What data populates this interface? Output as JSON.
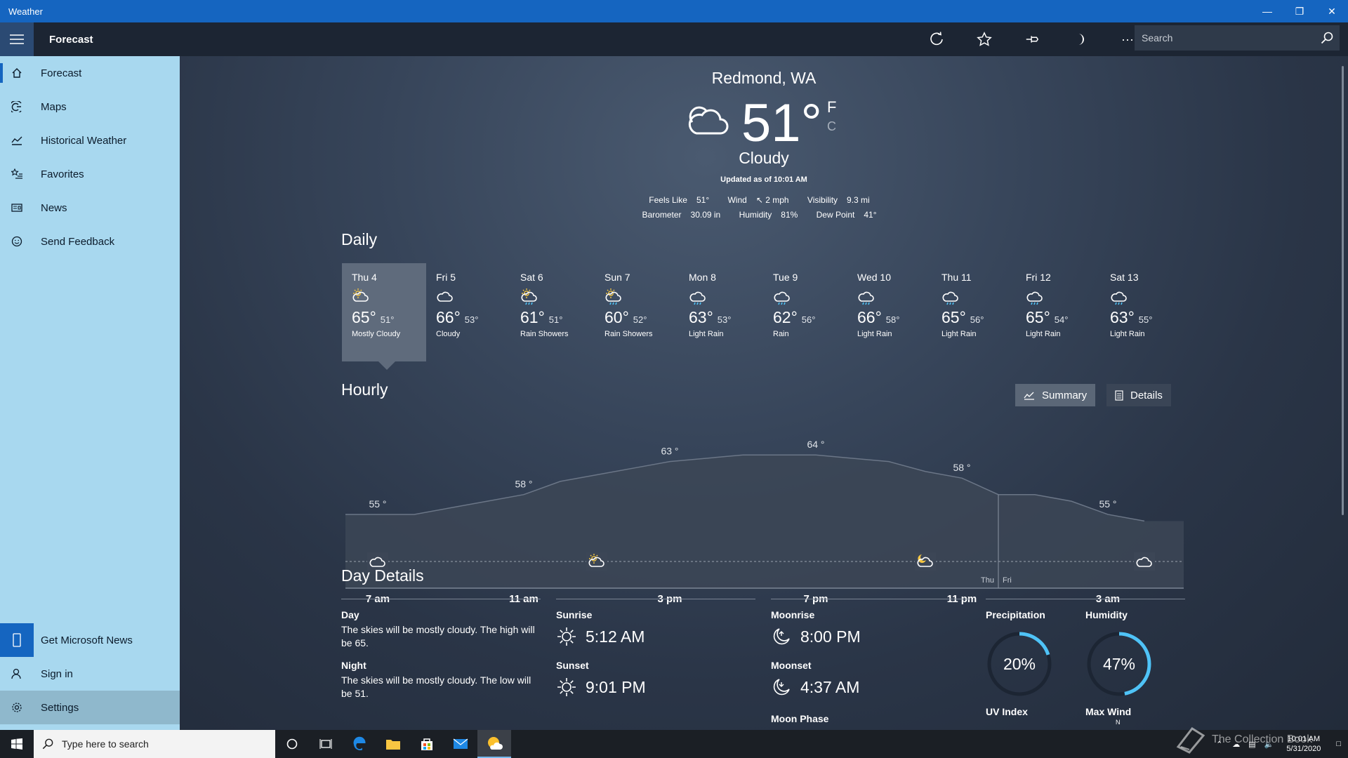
{
  "window": {
    "title": "Weather"
  },
  "header": {
    "page_title": "Forecast",
    "search_placeholder": "Search"
  },
  "sidebar": {
    "items": [
      {
        "label": "Forecast"
      },
      {
        "label": "Maps"
      },
      {
        "label": "Historical Weather"
      },
      {
        "label": "Favorites"
      },
      {
        "label": "News"
      },
      {
        "label": "Send Feedback"
      }
    ],
    "bottom": [
      {
        "label": "Get Microsoft News"
      },
      {
        "label": "Sign in"
      },
      {
        "label": "Settings"
      }
    ]
  },
  "current": {
    "location": "Redmond, WA",
    "temperature": "51°",
    "unit_f": "F",
    "unit_c": "C",
    "condition": "Cloudy",
    "updated": "Updated as of 10:01 AM",
    "feels_like_label": "Feels Like",
    "feels_like": "51°",
    "wind_label": "Wind",
    "wind": "↖ 2 mph",
    "visibility_label": "Visibility",
    "visibility": "9.3 mi",
    "barometer_label": "Barometer",
    "barometer": "30.09 in",
    "humidity_label": "Humidity",
    "humidity": "81%",
    "dew_point_label": "Dew Point",
    "dew_point": "41°"
  },
  "daily": {
    "title": "Daily",
    "days": [
      {
        "name": "Thu 4",
        "high": "65°",
        "low": "51°",
        "condition": "Mostly Cloudy",
        "icon": "partly-cloudy-icon"
      },
      {
        "name": "Fri 5",
        "high": "66°",
        "low": "53°",
        "condition": "Cloudy",
        "icon": "cloud-icon"
      },
      {
        "name": "Sat 6",
        "high": "61°",
        "low": "51°",
        "condition": "Rain Showers",
        "icon": "sun-rain-icon"
      },
      {
        "name": "Sun 7",
        "high": "60°",
        "low": "52°",
        "condition": "Rain Showers",
        "icon": "sun-rain-icon"
      },
      {
        "name": "Mon 8",
        "high": "63°",
        "low": "53°",
        "condition": "Light Rain",
        "icon": "rain-icon"
      },
      {
        "name": "Tue 9",
        "high": "62°",
        "low": "56°",
        "condition": "Rain",
        "icon": "rain-icon"
      },
      {
        "name": "Wed 10",
        "high": "66°",
        "low": "58°",
        "condition": "Light Rain",
        "icon": "rain-icon"
      },
      {
        "name": "Thu 11",
        "high": "65°",
        "low": "56°",
        "condition": "Light Rain",
        "icon": "rain-icon"
      },
      {
        "name": "Fri 12",
        "high": "65°",
        "low": "54°",
        "condition": "Light Rain",
        "icon": "rain-icon"
      },
      {
        "name": "Sat 13",
        "high": "63°",
        "low": "55°",
        "condition": "Light Rain",
        "icon": "rain-icon"
      }
    ]
  },
  "hourly": {
    "title": "Hourly",
    "summary_label": "Summary",
    "details_label": "Details",
    "day_split": [
      "Thu",
      "Fri"
    ]
  },
  "chart_data": {
    "type": "area",
    "x": [
      "7 am",
      "8 am",
      "9 am",
      "10 am",
      "11 am",
      "12 pm",
      "1 pm",
      "2 pm",
      "3 pm",
      "4 pm",
      "5 pm",
      "6 pm",
      "7 pm",
      "8 pm",
      "9 pm",
      "10 pm",
      "11 pm",
      "12 am",
      "1 am",
      "2 am",
      "3 am",
      "4 am"
    ],
    "values": [
      55,
      55,
      56,
      57,
      58,
      60,
      61,
      62,
      63,
      63.5,
      64,
      64,
      64,
      63.5,
      63,
      61.5,
      60.5,
      58,
      58,
      57,
      55,
      54
    ],
    "annotations": [
      {
        "x": "7 am",
        "label": "55 °"
      },
      {
        "x": "11 am",
        "label": "58 °"
      },
      {
        "x": "3 pm",
        "label": "63 °"
      },
      {
        "x": "7 pm",
        "label": "64 °"
      },
      {
        "x": "11 pm",
        "label": "58 °"
      },
      {
        "x": "3 am",
        "label": "55 °"
      }
    ],
    "xticks": [
      "7 am",
      "11 am",
      "3 pm",
      "7 pm",
      "11 pm",
      "3 am"
    ],
    "icons": [
      {
        "x": "7 am",
        "icon": "cloud-icon"
      },
      {
        "x": "1 pm",
        "icon": "partly-cloudy-icon"
      },
      {
        "x": "10 pm",
        "icon": "partly-cloudy-night-icon"
      },
      {
        "x": "4 am",
        "icon": "cloud-icon"
      }
    ],
    "grid": false
  },
  "day_details": {
    "title": "Day Details",
    "day_label": "Day",
    "day_text": "The skies will be mostly cloudy. The high will be 65.",
    "night_label": "Night",
    "night_text": "The skies will be mostly cloudy. The low will be 51.",
    "sunrise_label": "Sunrise",
    "sunrise": "5:12 AM",
    "sunset_label": "Sunset",
    "sunset": "9:01 PM",
    "moonrise_label": "Moonrise",
    "moonrise": "8:00 PM",
    "moonset_label": "Moonset",
    "moonset": "4:37 AM",
    "moon_phase_label": "Moon Phase",
    "precipitation_label": "Precipitation",
    "precipitation": "20%",
    "precipitation_fraction": 0.2,
    "humidity_label": "Humidity",
    "humidity": "47%",
    "humidity_fraction": 0.47,
    "uv_label": "UV Index",
    "max_wind_label": "Max Wind",
    "max_wind_dir": "N"
  },
  "taskbar": {
    "search_placeholder": "Type here to search",
    "time": "10:01 AM",
    "date": "5/31/2020",
    "watermark": "The Collection Book"
  },
  "colors": {
    "accent": "#1565c0",
    "sidebar": "#a8d8ef",
    "gauge": "#4fc3f7"
  }
}
